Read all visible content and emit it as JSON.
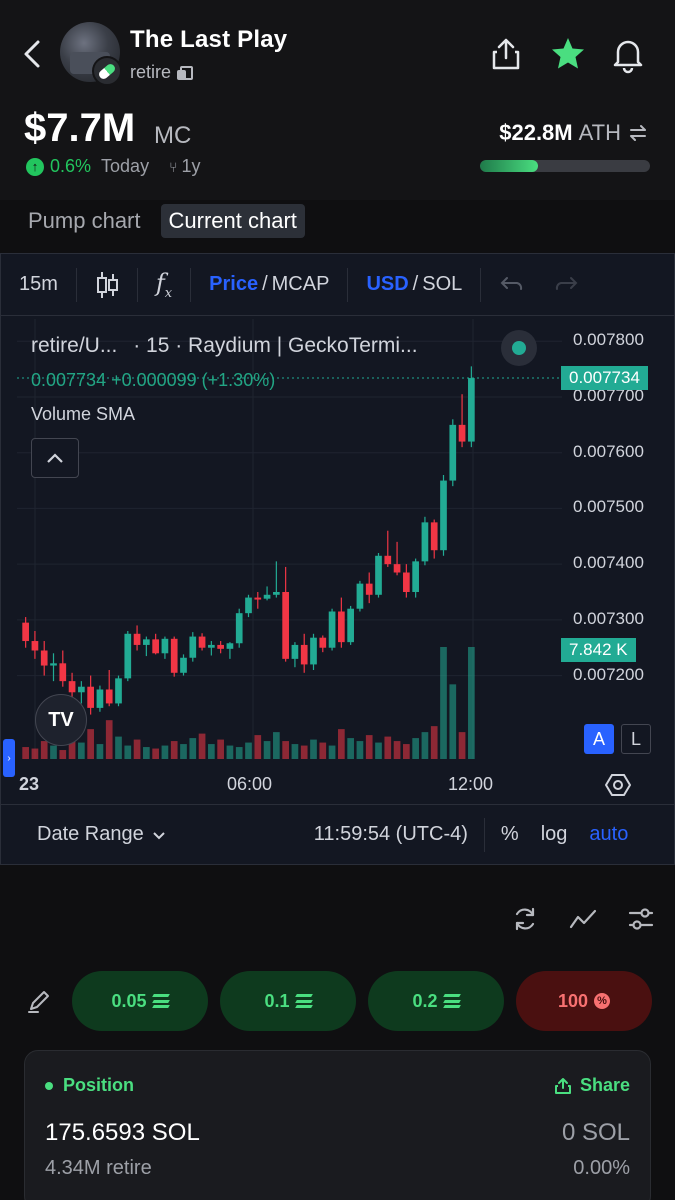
{
  "header": {
    "token_name": "The Last Play",
    "ticker": "retire",
    "market_cap": "$7.7M",
    "market_cap_label": "MC",
    "change": "0.6%",
    "change_period": "Today",
    "timeframe": "1y",
    "ath_value": "$22.8M",
    "ath_label": "ATH",
    "ath_progress_pct": 34
  },
  "chart_tabs": [
    {
      "label": "Pump chart",
      "active": false
    },
    {
      "label": "Current chart",
      "active": true
    }
  ],
  "toolbar": {
    "interval": "15m",
    "price_label": "Price",
    "mcap_label": "MCAP",
    "usd_label": "USD",
    "sol_label": "SOL",
    "separator": "/"
  },
  "chart": {
    "pair": "retire/U...",
    "source": "· 15 · Raydium | GeckoTermi...",
    "ohlc": "0.007734 +0.000099 (+1.30%)",
    "volume_indicator": "Volume SMA",
    "price_ticks": [
      "0.007800",
      "0.007700",
      "0.007600",
      "0.007500",
      "0.007400",
      "0.007300",
      "0.007200"
    ],
    "last_price": "0.007734",
    "volume_tag": "7.842 K",
    "time_labels": [
      "23",
      "06:00",
      "12:00"
    ],
    "scale_a": "A",
    "scale_l": "L",
    "date_range_label": "Date Range",
    "clock": "11:59:54 (UTC-4)",
    "pct_label": "%",
    "log_label": "log",
    "auto_label": "auto",
    "logo_text": "TV",
    "colors": {
      "up": "#22ab94",
      "down": "#f23645",
      "bg": "#131722"
    }
  },
  "chart_data": {
    "type": "candlestick",
    "y_range": [
      0.00714,
      0.00784
    ],
    "last": 0.007734,
    "candles": [
      [
        0.007295,
        0.007305,
        0.00725,
        0.007262
      ],
      [
        0.007262,
        0.00728,
        0.00723,
        0.007245
      ],
      [
        0.007245,
        0.007262,
        0.0072,
        0.007218
      ],
      [
        0.007218,
        0.00724,
        0.00719,
        0.007222
      ],
      [
        0.007222,
        0.007245,
        0.00718,
        0.00719
      ],
      [
        0.00719,
        0.007205,
        0.00716,
        0.00717
      ],
      [
        0.00717,
        0.00719,
        0.00715,
        0.00718
      ],
      [
        0.00718,
        0.0072,
        0.00713,
        0.007142
      ],
      [
        0.007142,
        0.007182,
        0.007135,
        0.007175
      ],
      [
        0.007175,
        0.00721,
        0.007145,
        0.00715
      ],
      [
        0.00715,
        0.0072,
        0.007145,
        0.007195
      ],
      [
        0.007195,
        0.00728,
        0.00719,
        0.007275
      ],
      [
        0.007275,
        0.00729,
        0.007245,
        0.007255
      ],
      [
        0.007255,
        0.00727,
        0.007235,
        0.007265
      ],
      [
        0.007265,
        0.007275,
        0.007238,
        0.00724
      ],
      [
        0.00724,
        0.00727,
        0.00723,
        0.007266
      ],
      [
        0.007266,
        0.00727,
        0.007198,
        0.007205
      ],
      [
        0.007205,
        0.007238,
        0.0072,
        0.007232
      ],
      [
        0.007232,
        0.007278,
        0.007225,
        0.00727
      ],
      [
        0.00727,
        0.007276,
        0.007245,
        0.00725
      ],
      [
        0.00725,
        0.007262,
        0.007236,
        0.007255
      ],
      [
        0.007255,
        0.007262,
        0.00724,
        0.007248
      ],
      [
        0.007248,
        0.00726,
        0.00723,
        0.007258
      ],
      [
        0.007258,
        0.00732,
        0.00725,
        0.007312
      ],
      [
        0.007312,
        0.007345,
        0.007305,
        0.00734
      ],
      [
        0.00734,
        0.00735,
        0.00732,
        0.007338
      ],
      [
        0.007338,
        0.00736,
        0.007335,
        0.007345
      ],
      [
        0.007345,
        0.007405,
        0.00734,
        0.00735
      ],
      [
        0.00735,
        0.007395,
        0.007225,
        0.00723
      ],
      [
        0.00723,
        0.00726,
        0.007215,
        0.007255
      ],
      [
        0.007255,
        0.007275,
        0.007205,
        0.00722
      ],
      [
        0.00722,
        0.007275,
        0.00721,
        0.007268
      ],
      [
        0.007268,
        0.007272,
        0.007242,
        0.00725
      ],
      [
        0.00725,
        0.00732,
        0.007245,
        0.007315
      ],
      [
        0.007315,
        0.00734,
        0.00725,
        0.00726
      ],
      [
        0.00726,
        0.007325,
        0.007255,
        0.00732
      ],
      [
        0.00732,
        0.00737,
        0.007315,
        0.007365
      ],
      [
        0.007365,
        0.007385,
        0.00733,
        0.007345
      ],
      [
        0.007345,
        0.00742,
        0.00734,
        0.007415
      ],
      [
        0.007415,
        0.00746,
        0.007395,
        0.0074
      ],
      [
        0.0074,
        0.00744,
        0.00738,
        0.007385
      ],
      [
        0.007385,
        0.0074,
        0.00734,
        0.00735
      ],
      [
        0.00735,
        0.00741,
        0.00734,
        0.007405
      ],
      [
        0.007405,
        0.007485,
        0.007398,
        0.007475
      ],
      [
        0.007475,
        0.00748,
        0.00741,
        0.007425
      ],
      [
        0.007425,
        0.00756,
        0.007415,
        0.00755
      ],
      [
        0.00755,
        0.00766,
        0.00754,
        0.00765
      ],
      [
        0.00765,
        0.007705,
        0.00761,
        0.00762
      ],
      [
        0.00762,
        0.007755,
        0.00761,
        0.007734
      ]
    ],
    "volume": [
      8,
      7,
      12,
      9,
      6,
      14,
      11,
      20,
      10,
      26,
      15,
      9,
      13,
      8,
      7,
      9,
      12,
      10,
      14,
      17,
      10,
      13,
      9,
      8,
      11,
      16,
      12,
      18,
      12,
      10,
      9,
      13,
      11,
      9,
      20,
      14,
      12,
      16,
      11,
      15,
      12,
      10,
      14,
      18,
      22,
      75,
      50,
      18,
      75
    ],
    "title": "",
    "xlabel": "",
    "ylabel": ""
  },
  "tools": [
    "refresh-icon",
    "line-chart-icon",
    "sliders-icon"
  ],
  "quick_buys": [
    {
      "label": "0.05",
      "kind": "buy"
    },
    {
      "label": "0.1",
      "kind": "buy"
    },
    {
      "label": "0.2",
      "kind": "buy"
    },
    {
      "label": "100",
      "kind": "sell"
    }
  ],
  "position": {
    "title": "Position",
    "share_label": "Share",
    "sol_amount": "175.6593 SOL",
    "token_amount": "4.34M retire",
    "value": "0 SOL",
    "pnl": "0.00%"
  }
}
